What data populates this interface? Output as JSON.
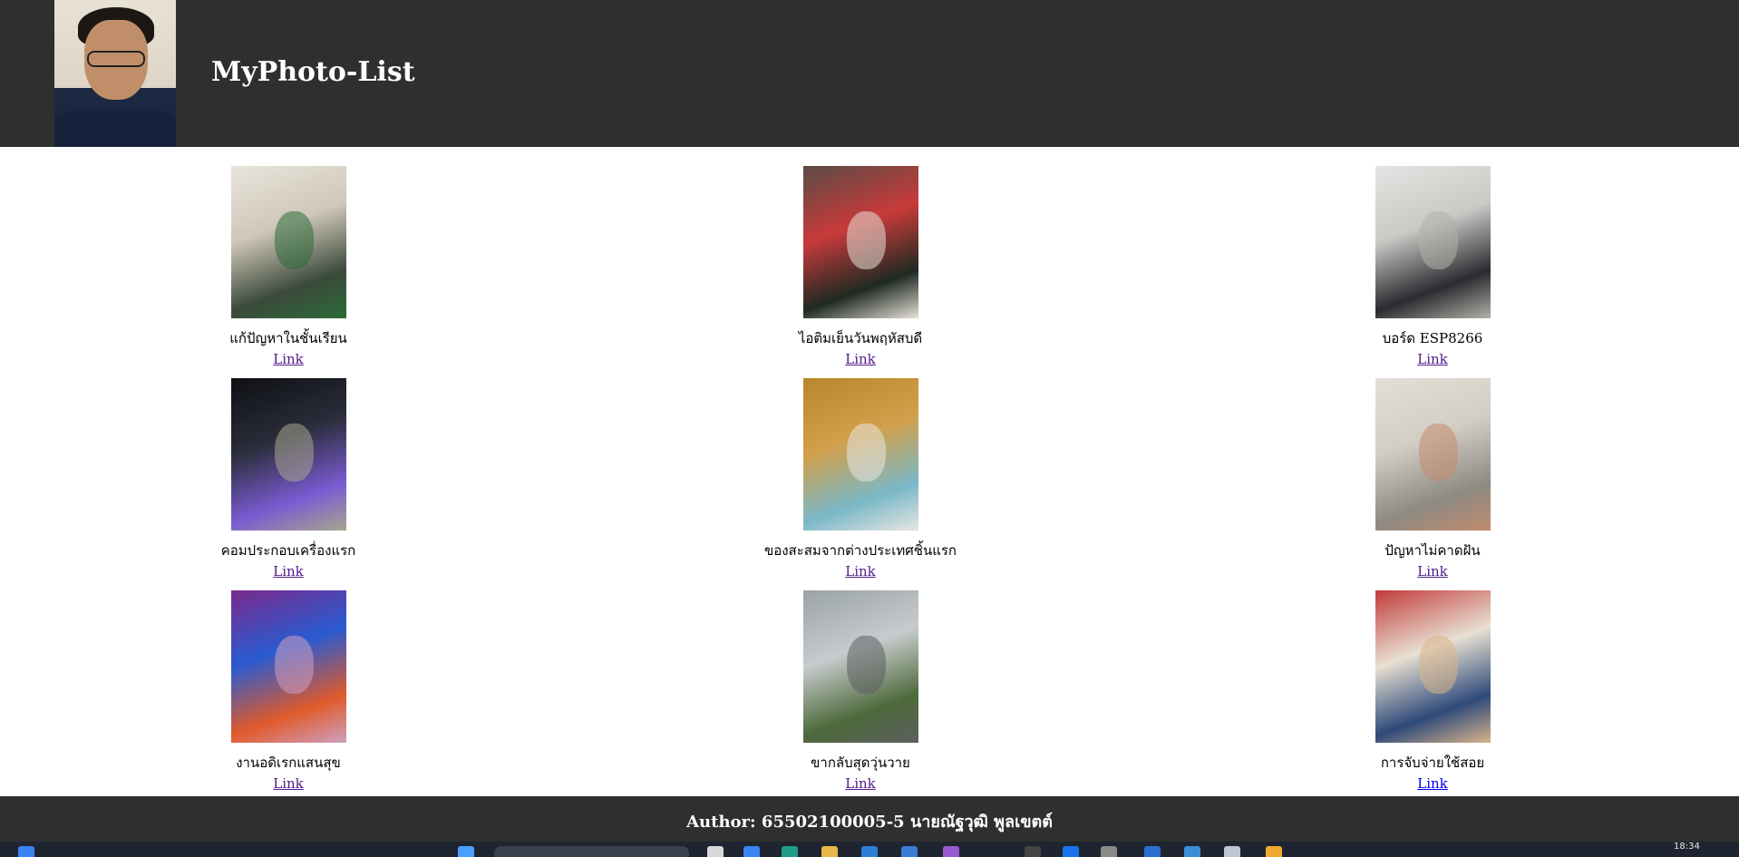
{
  "header": {
    "title": "MyPhoto-List",
    "avatar_icon": "profile-photo"
  },
  "photos": [
    {
      "caption": "แก้ปัญหาในชั้นเรียน",
      "link": "Link",
      "link_color": "#551a8b",
      "palette": [
        "#e9e5dc",
        "#cfc7b9",
        "#3b4a3a",
        "#2c6b3a"
      ]
    },
    {
      "caption": "ไอติมเย็นวันพฤหัสบดี",
      "link": "Link",
      "link_color": "#551a8b",
      "palette": [
        "#5b4c45",
        "#c83a3a",
        "#1f2a22",
        "#e6e1d8"
      ]
    },
    {
      "caption": "บอร์ด ESP8266",
      "link": "Link",
      "link_color": "#551a8b",
      "palette": [
        "#e4e4e2",
        "#c9c9c6",
        "#2b2b30",
        "#b3b0a8"
      ]
    },
    {
      "caption": "คอมประกอบเครื่องแรก",
      "link": "Link",
      "link_color": "#551a8b",
      "palette": [
        "#0f1014",
        "#2a2d3a",
        "#7a5bd1",
        "#a7a58f"
      ]
    },
    {
      "caption": "ของสะสมจากต่างประเทศชิ้นแรก",
      "link": "Link",
      "link_color": "#551a8b",
      "palette": [
        "#b8862e",
        "#d2a04a",
        "#7ab8c8",
        "#e8e6e0"
      ]
    },
    {
      "caption": "ปัญหาไม่คาดฝัน",
      "link": "Link",
      "link_color": "#551a8b",
      "palette": [
        "#e3dfd6",
        "#d2cec4",
        "#8d8a82",
        "#c28b6e"
      ]
    },
    {
      "caption": "งานอดิเรกแสนสุข",
      "link": "Link",
      "link_color": "#551a8b",
      "palette": [
        "#7a2a8c",
        "#2a5bd0",
        "#e05a2a",
        "#cfa0c0"
      ]
    },
    {
      "caption": "ขากลับสุดวุ่นวาย",
      "link": "Link",
      "link_color": "#551a8b",
      "palette": [
        "#9aa3a8",
        "#c7cbcd",
        "#4d6a3b",
        "#5c5f60"
      ]
    },
    {
      "caption": "การจับจ่ายใช้สอย",
      "link": "Link",
      "link_color": "#0000ee",
      "palette": [
        "#c23a3a",
        "#e8e0d2",
        "#2e4a7a",
        "#d9b48a"
      ]
    }
  ],
  "footer": {
    "text": "Author: 65502100005-5 นายณัฐวุฒิ พูลเขตต์"
  },
  "taskbar": {
    "clock": "18:34"
  }
}
